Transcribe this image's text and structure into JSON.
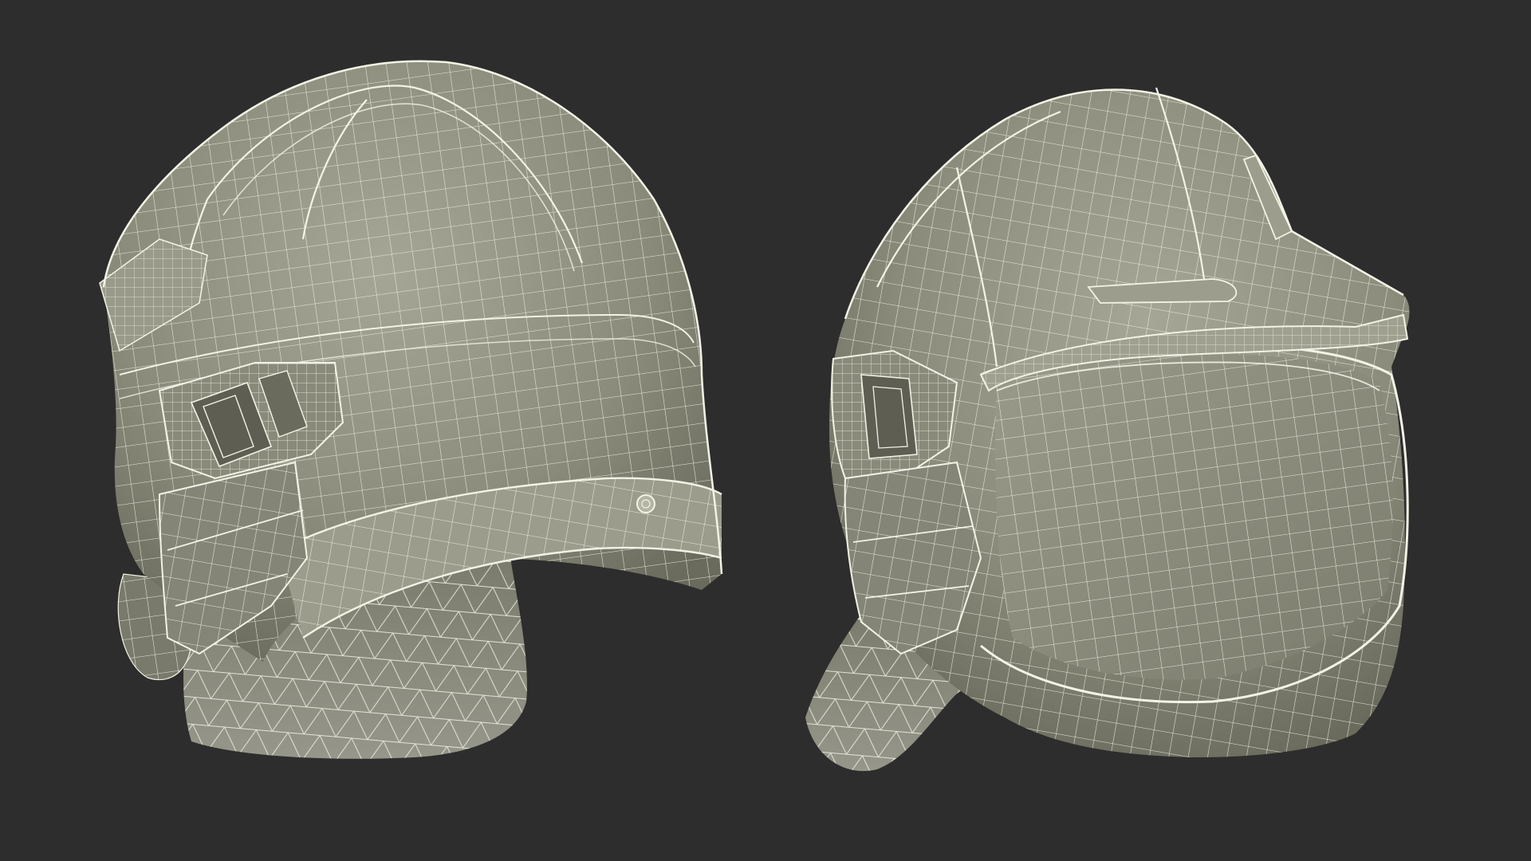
{
  "scene": {
    "background": "#2d2d2d",
    "shell_fill": "#8a8a7a",
    "shell_fill_light": "#a3a393",
    "shell_fill_dark": "#6c6c5f",
    "wire_color": "#f2f2e6",
    "views": [
      {
        "name": "helmet-three-quarter-left"
      },
      {
        "name": "helmet-three-quarter-right"
      }
    ]
  }
}
